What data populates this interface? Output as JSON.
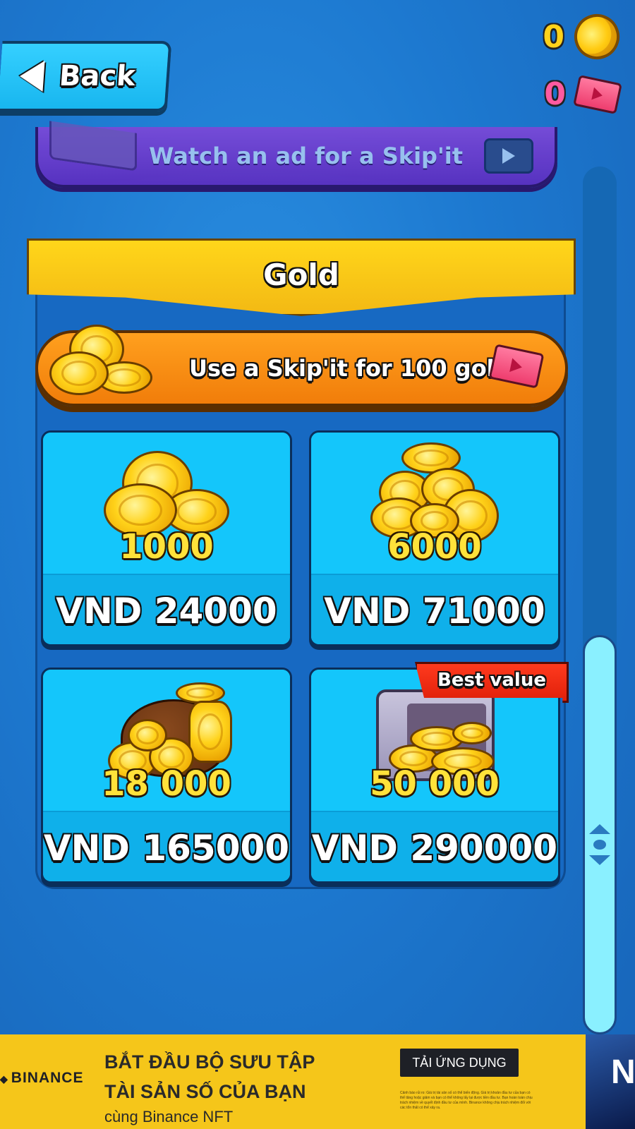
{
  "header": {
    "back_label": "Back",
    "gold_count": "0",
    "ticket_count": "0"
  },
  "ad_strip": {
    "label": "Watch an ad for a Skip'it"
  },
  "shop": {
    "section_title": "Gold",
    "skip_offer_label": "Use a Skip'it for 100 gold",
    "best_value_label": "Best value",
    "products": [
      {
        "amount": "1000",
        "price": "VND 24000"
      },
      {
        "amount": "6000",
        "price": "VND 71000"
      },
      {
        "amount": "18 000",
        "price": "VND 165000"
      },
      {
        "amount": "50 000",
        "price": "VND 290000"
      }
    ]
  },
  "scrollbar": {
    "position_fraction": 0.66
  },
  "banner_ad": {
    "brand": "BINANCE",
    "headline_1": "BẮT ĐẦU BỘ SƯU TẬP",
    "headline_2": "TÀI SẢN SỐ CỦA BẠN",
    "subline": "cùng Binance NFT",
    "cta": "TẢI ỨNG DỤNG",
    "fine_print": "Cảnh báo rủi ro: Giá trị tài sản số có thể biến động. Giá trị khoản đầu tư của bạn có thể tăng hoặc giảm và bạn có thể không lấy lại được tiền đầu tư. Bạn hoàn toàn chịu trách nhiệm về quyết định đầu tư của mình. Binance không chịu trách nhiệm đối với các tổn thất có thể xảy ra.",
    "image_text": "N"
  },
  "colors": {
    "background": "#1d79d0",
    "gold_banner": "#ffd61a",
    "skip_button": "#f38a10",
    "card": "#11bff5",
    "best_value": "#e8260e",
    "ad_strip": "#6a3ccc",
    "ad_background": "#f5c61a"
  },
  "icons": {
    "back": "back-arrow-icon",
    "gold": "gold-coin-icon",
    "ticket": "skipit-ticket-icon",
    "ad_play": "video-play-icon"
  }
}
